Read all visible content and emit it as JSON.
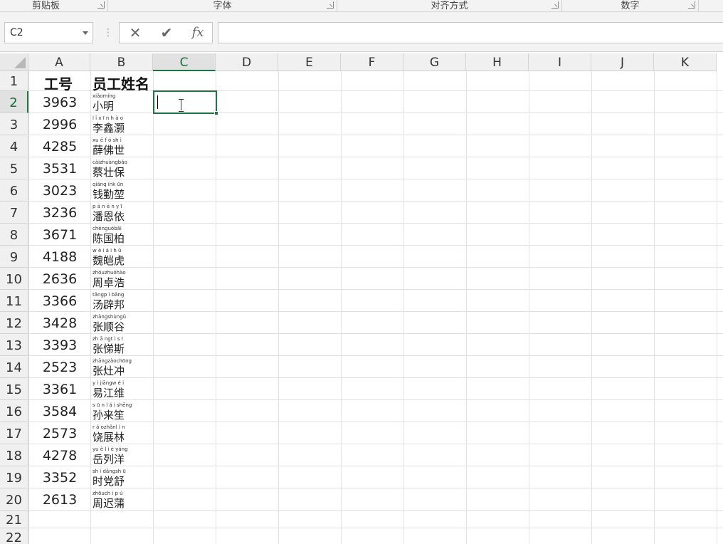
{
  "ribbon": {
    "groups": [
      "剪贴板",
      "字体",
      "对齐方式",
      "数字"
    ]
  },
  "formula_bar": {
    "name_box": "C2",
    "cancel_glyph": "✕",
    "enter_glyph": "✔",
    "fx_glyph": "fx",
    "value": ""
  },
  "columns": [
    "A",
    "B",
    "C",
    "D",
    "E",
    "F",
    "G",
    "H",
    "I",
    "J",
    "K"
  ],
  "selected_column": "C",
  "rows": [
    "1",
    "2",
    "3",
    "4",
    "5",
    "6",
    "7",
    "8",
    "9",
    "10",
    "11",
    "12",
    "13",
    "14",
    "15",
    "16",
    "17",
    "18",
    "19",
    "20",
    "21",
    "22"
  ],
  "selected_row": "2",
  "header": {
    "col_a": "工号",
    "col_b": "员工姓名"
  },
  "records": [
    {
      "id": "3963",
      "name": "小明",
      "pinyin": "xiǎomíng"
    },
    {
      "id": "2996",
      "name": "李鑫灏",
      "pinyin": "l ǐ x ī n h à o"
    },
    {
      "id": "4285",
      "name": "薛佛世",
      "pinyin": "xu ē f ó sh ì"
    },
    {
      "id": "3531",
      "name": "蔡壮保",
      "pinyin": "càizhuàngbǎo"
    },
    {
      "id": "3023",
      "name": "钱勤堃",
      "pinyin": "qiánq ínk ūn"
    },
    {
      "id": "3236",
      "name": "潘恩依",
      "pinyin": "p ā n ē n y ī"
    },
    {
      "id": "3671",
      "name": "陈国柏",
      "pinyin": "chénguóbǎi"
    },
    {
      "id": "4188",
      "name": "魏皑虎",
      "pinyin": "w è i á i h ǔ"
    },
    {
      "id": "2636",
      "name": "周卓浩",
      "pinyin": "zhōuzhuóhào"
    },
    {
      "id": "3366",
      "name": "汤辟邦",
      "pinyin": "tāngp ì bāng"
    },
    {
      "id": "3428",
      "name": "张顺谷",
      "pinyin": "zhāngshùngǔ"
    },
    {
      "id": "3393",
      "name": "张悌斯",
      "pinyin": "zh ā ngt ì s ī"
    },
    {
      "id": "2523",
      "name": "张灶冲",
      "pinyin": "zhāngzàochōng"
    },
    {
      "id": "3361",
      "name": "易江维",
      "pinyin": "y ì jiāngw é i"
    },
    {
      "id": "3584",
      "name": "孙来笙",
      "pinyin": "s ū n l á i shēng"
    },
    {
      "id": "2573",
      "name": "饶展林",
      "pinyin": "r á ozhǎnl í n"
    },
    {
      "id": "4278",
      "name": "岳列洋",
      "pinyin": "yu è l i è yáng"
    },
    {
      "id": "3352",
      "name": "时党舒",
      "pinyin": "sh í dǎngsh ū"
    },
    {
      "id": "2613",
      "name": "周迟蒲",
      "pinyin": "zhōuch í p ú"
    }
  ],
  "active_cell": "C2"
}
